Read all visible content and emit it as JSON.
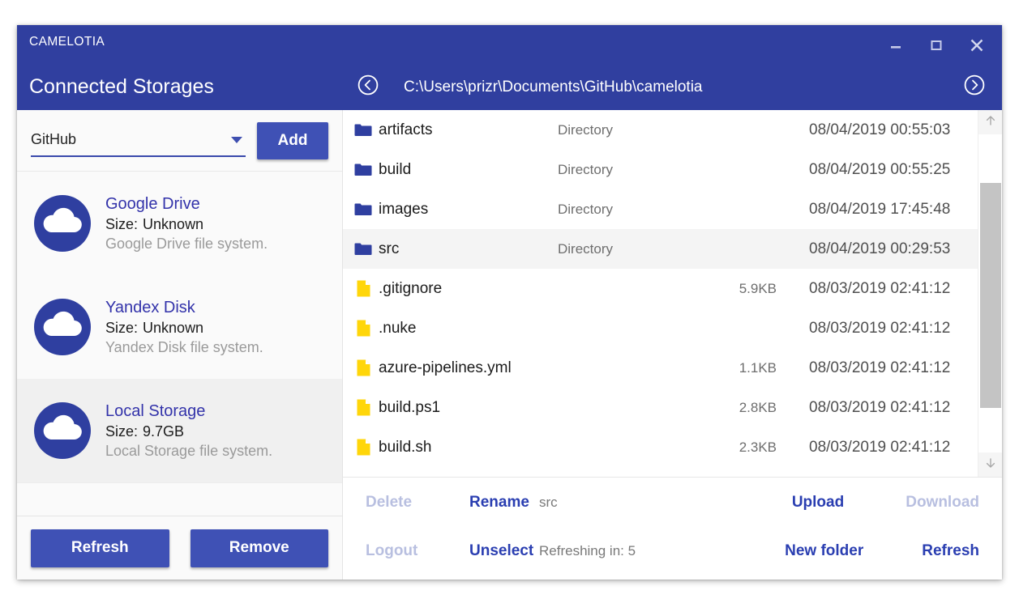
{
  "window": {
    "app_name": "CAMELOTIA",
    "controls": {
      "minimize": "minimize-icon",
      "maximize": "maximize-icon",
      "close": "close-icon"
    }
  },
  "left_panel": {
    "title": "Connected Storages",
    "provider_select": {
      "value": "GitHub",
      "options": [
        "GitHub",
        "Google Drive",
        "Yandex Disk",
        "Local Storage"
      ]
    },
    "add_label": "Add",
    "size_label": "Size:",
    "storages": [
      {
        "name": "Google Drive",
        "size": "Unknown",
        "description": "Google Drive file system.",
        "selected": false
      },
      {
        "name": "Yandex Disk",
        "size": "Unknown",
        "description": "Yandex Disk file system.",
        "selected": false
      },
      {
        "name": "Local Storage",
        "size": "9.7GB",
        "description": "Local Storage file system.",
        "selected": true
      }
    ],
    "refresh_label": "Refresh",
    "remove_label": "Remove"
  },
  "right_panel": {
    "path": "C:\\Users\\prizr\\Documents\\GitHub\\camelotia",
    "back_icon": "circle-chevron-left-icon",
    "forward_icon": "circle-chevron-right-icon",
    "files": [
      {
        "name": "artifacts",
        "type": "Directory",
        "size": "",
        "modified": "08/04/2019 00:55:03",
        "icon": "folder-icon",
        "selected": false
      },
      {
        "name": "build",
        "type": "Directory",
        "size": "",
        "modified": "08/04/2019 00:55:25",
        "icon": "folder-icon",
        "selected": false
      },
      {
        "name": "images",
        "type": "Directory",
        "size": "",
        "modified": "08/04/2019 17:45:48",
        "icon": "folder-icon",
        "selected": false
      },
      {
        "name": "src",
        "type": "Directory",
        "size": "",
        "modified": "08/04/2019 00:29:53",
        "icon": "folder-icon",
        "selected": true
      },
      {
        "name": ".gitignore",
        "type": "",
        "size": "5.9KB",
        "modified": "08/03/2019 02:41:12",
        "icon": "file-icon",
        "selected": false
      },
      {
        "name": ".nuke",
        "type": "",
        "size": "",
        "modified": "08/03/2019 02:41:12",
        "icon": "file-icon",
        "selected": false
      },
      {
        "name": "azure-pipelines.yml",
        "type": "",
        "size": "1.1KB",
        "modified": "08/03/2019 02:41:12",
        "icon": "file-icon",
        "selected": false
      },
      {
        "name": "build.ps1",
        "type": "",
        "size": "2.8KB",
        "modified": "08/03/2019 02:41:12",
        "icon": "file-icon",
        "selected": false
      },
      {
        "name": "build.sh",
        "type": "",
        "size": "2.3KB",
        "modified": "08/03/2019 02:41:12",
        "icon": "file-icon",
        "selected": false
      }
    ],
    "toolbar": {
      "delete_label": "Delete",
      "rename_label": "Rename",
      "selection_status": "src",
      "upload_label": "Upload",
      "download_label": "Download",
      "logout_label": "Logout",
      "unselect_label": "Unselect",
      "refresh_status": "Refreshing in: 5",
      "new_folder_label": "New folder",
      "refresh_label": "Refresh"
    }
  },
  "colors": {
    "brand_blue": "#303f9f",
    "button_blue": "#3f51b5",
    "link_blue": "#2a3eb1",
    "folder_blue": "#2f3fa0",
    "file_yellow": "#ffd60a",
    "disabled": "#b8bfe0",
    "selected_row": "#f0f0f0"
  }
}
